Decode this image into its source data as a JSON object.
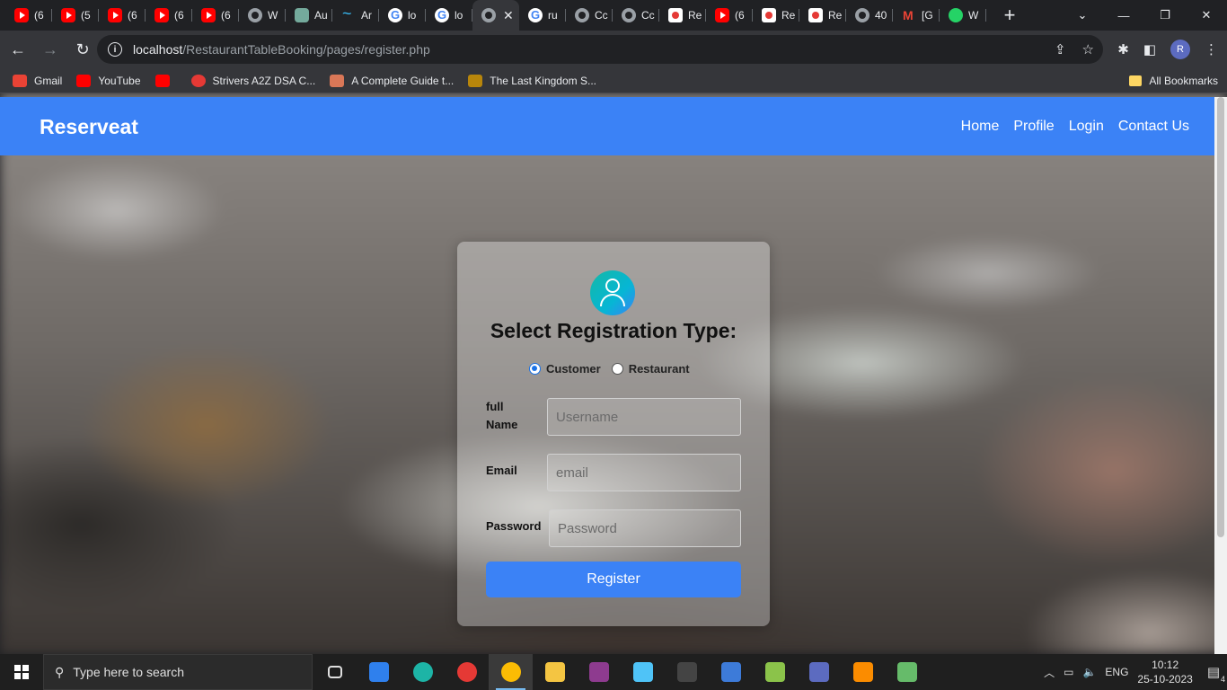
{
  "browser": {
    "tabs": [
      {
        "title": "(6",
        "icon": "youtube-icon",
        "fav": "fav-yt"
      },
      {
        "title": "(5",
        "icon": "youtube-icon",
        "fav": "fav-yt"
      },
      {
        "title": "(6",
        "icon": "youtube-icon",
        "fav": "fav-yt"
      },
      {
        "title": "(6",
        "icon": "youtube-icon",
        "fav": "fav-yt"
      },
      {
        "title": "(6",
        "icon": "youtube-icon",
        "fav": "fav-yt"
      },
      {
        "title": "W",
        "icon": "globe-icon",
        "fav": "fav-globe"
      },
      {
        "title": "Au",
        "icon": "chatgpt-icon",
        "fav": "fav-gpt"
      },
      {
        "title": "Ar",
        "icon": "tailwind-icon",
        "fav": "fav-tw"
      },
      {
        "title": "lo",
        "icon": "google-icon",
        "fav": "fav-g"
      },
      {
        "title": "lo",
        "icon": "google-icon",
        "fav": "fav-g"
      },
      {
        "title": "",
        "icon": "globe-icon",
        "fav": "fav-globe",
        "active": true
      },
      {
        "title": "ru",
        "icon": "google-icon",
        "fav": "fav-g"
      },
      {
        "title": "Cc",
        "icon": "globe-icon",
        "fav": "fav-globe"
      },
      {
        "title": "Cc",
        "icon": "globe-icon",
        "fav": "fav-globe"
      },
      {
        "title": "Re",
        "icon": "react-icon",
        "fav": "fav-re"
      },
      {
        "title": "(6",
        "icon": "youtube-icon",
        "fav": "fav-yt"
      },
      {
        "title": "Re",
        "icon": "react-icon",
        "fav": "fav-re"
      },
      {
        "title": "Re",
        "icon": "react-icon",
        "fav": "fav-re"
      },
      {
        "title": "40",
        "icon": "globe-icon",
        "fav": "fav-globe"
      },
      {
        "title": "[G",
        "icon": "gmail-icon",
        "fav": "fav-gm"
      },
      {
        "title": "W",
        "icon": "whatsapp-icon",
        "fav": "fav-wa"
      }
    ],
    "url_host": "localhost",
    "url_path": "/RestaurantTableBooking/pages/register.php",
    "profile_initial": "R",
    "bookmarks": [
      {
        "label": "Gmail",
        "icon": "gmail-icon"
      },
      {
        "label": "YouTube",
        "icon": "youtube-icon"
      },
      {
        "label": "",
        "icon": "youtube-icon"
      },
      {
        "label": "Strivers A2Z DSA C...",
        "icon": "tuf-icon"
      },
      {
        "label": "A Complete Guide t...",
        "icon": "asterisk-icon"
      },
      {
        "label": "The Last Kingdom S...",
        "icon": "film-icon"
      }
    ],
    "all_bookmarks": "All Bookmarks"
  },
  "site": {
    "brand": "Reserveat",
    "nav": [
      "Home",
      "Profile",
      "Login",
      "Contact Us"
    ],
    "accent": "#3b82f6"
  },
  "form": {
    "title": "Select Registration Type:",
    "types": [
      {
        "label": "Customer",
        "checked": true
      },
      {
        "label": "Restaurant",
        "checked": false
      }
    ],
    "fields": [
      {
        "label_line1": "full",
        "label_line2": "Name",
        "placeholder": "Username"
      },
      {
        "label_line1": "Email",
        "label_line2": "",
        "placeholder": "email"
      },
      {
        "label_line1": "Password",
        "label_line2": "",
        "placeholder": "Password"
      }
    ],
    "submit": "Register"
  },
  "taskbar": {
    "search_placeholder": "Type here to search",
    "apps": [
      "task-view-icon",
      "vscode-icon",
      "edge-icon",
      "opera-icon",
      "chrome-icon",
      "file-explorer-icon",
      "winrar-icon",
      "notepad-icon",
      "terminal-icon",
      "control-panel-icon",
      "arrow-app-icon",
      "sql-icon",
      "xampp-icon",
      "app-icon"
    ],
    "language": "ENG",
    "time": "10:12",
    "date": "25-10-2023",
    "notifications": "4"
  }
}
